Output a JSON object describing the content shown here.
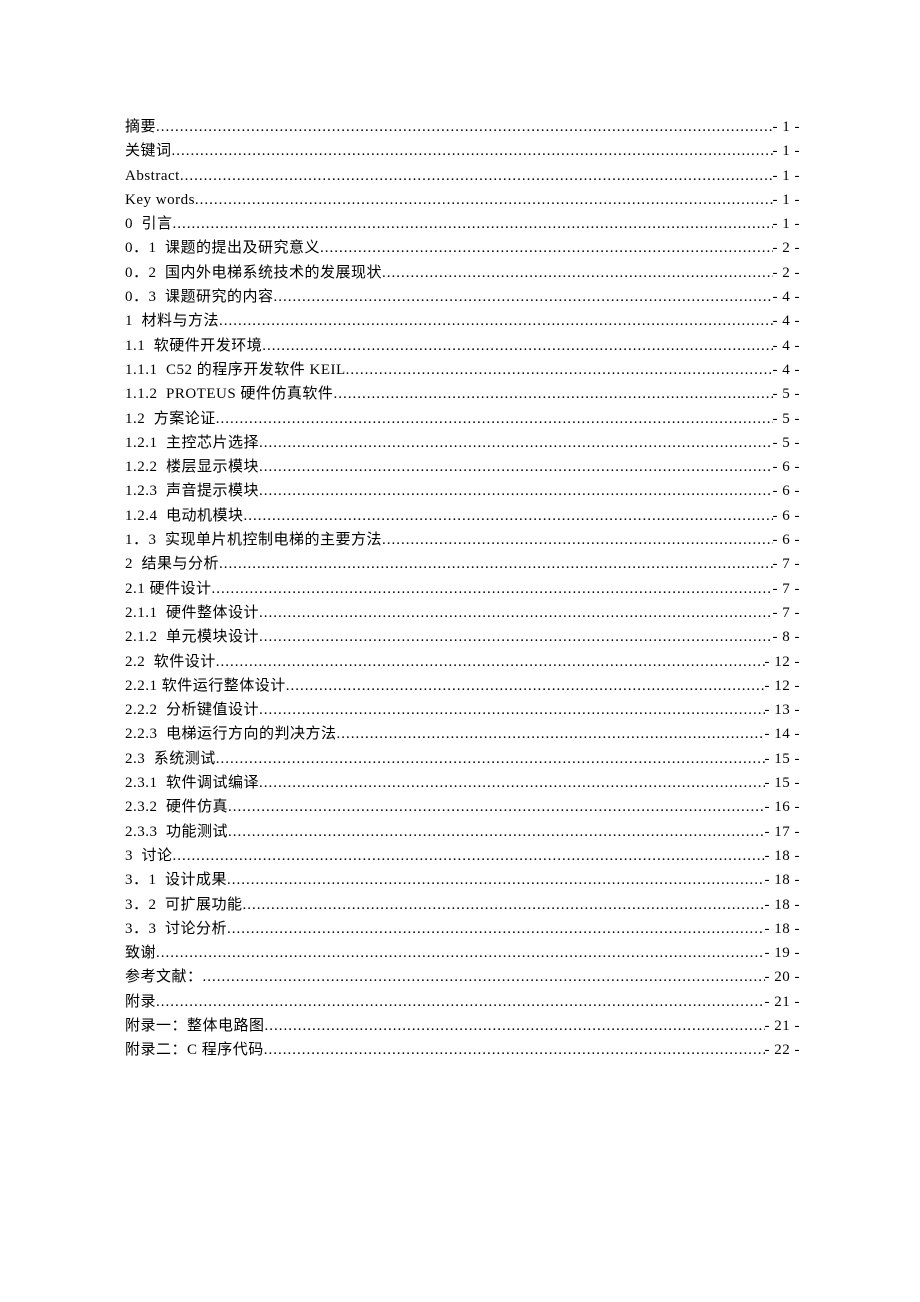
{
  "toc": [
    {
      "label": "摘要",
      "page": "- 1 -"
    },
    {
      "label": "关键词",
      "page": "- 1 -"
    },
    {
      "label": "Abstract",
      "page": "- 1 -"
    },
    {
      "label": "Key words",
      "page": "- 1 -"
    },
    {
      "label": "0  引言",
      "page": "- 1 -"
    },
    {
      "label": "0．1  课题的提出及研究意义",
      "page": "- 2 -"
    },
    {
      "label": "0．2  国内外电梯系统技术的发展现状",
      "page": "- 2 -"
    },
    {
      "label": "0．3  课题研究的内容",
      "page": "- 4 -"
    },
    {
      "label": "1  材料与方法",
      "page": "- 4 -"
    },
    {
      "label": "1.1  软硬件开发环境",
      "page": "- 4 -"
    },
    {
      "label": "1.1.1  C52 的程序开发软件 KEIL",
      "page": "- 4 -",
      "sc": true
    },
    {
      "label": "1.1.2  PROTEUS 硬件仿真软件",
      "page": "- 5 -",
      "sc": true
    },
    {
      "label": "1.2  方案论证",
      "page": "- 5 -"
    },
    {
      "label": "1.2.1  主控芯片选择",
      "page": "- 5 -"
    },
    {
      "label": "1.2.2  楼层显示模块",
      "page": "- 6 -"
    },
    {
      "label": "1.2.3  声音提示模块",
      "page": "- 6 -"
    },
    {
      "label": "1.2.4  电动机模块",
      "page": "- 6 -"
    },
    {
      "label": "1．3  实现单片机控制电梯的主要方法",
      "page": "- 6 -"
    },
    {
      "label": "2  结果与分析",
      "page": "- 7 -"
    },
    {
      "label": "2.1 硬件设计",
      "page": "- 7 -"
    },
    {
      "label": "2.1.1  硬件整体设计",
      "page": "- 7 -"
    },
    {
      "label": "2.1.2  单元模块设计",
      "page": "- 8 -"
    },
    {
      "label": "2.2  软件设计",
      "page": "- 12 -"
    },
    {
      "label": "2.2.1 软件运行整体设计",
      "page": "- 12 -"
    },
    {
      "label": "2.2.2  分析键值设计",
      "page": "- 13 -"
    },
    {
      "label": "2.2.3  电梯运行方向的判决方法",
      "page": "- 14 -"
    },
    {
      "label": "2.3  系统测试",
      "page": "- 15 -"
    },
    {
      "label": "2.3.1  软件调试编译",
      "page": "- 15 -"
    },
    {
      "label": "2.3.2  硬件仿真",
      "page": "- 16 -"
    },
    {
      "label": "2.3.3  功能测试",
      "page": "- 17 -"
    },
    {
      "label": "3  讨论",
      "page": "- 18 -"
    },
    {
      "label": "3．1  设计成果",
      "page": "- 18 -"
    },
    {
      "label": "3．2  可扩展功能",
      "page": "- 18 -"
    },
    {
      "label": "3．3  讨论分析",
      "page": "- 18 -"
    },
    {
      "label": "致谢",
      "page": "- 19 -"
    },
    {
      "label": "参考文献：",
      "page": "- 20 -"
    },
    {
      "label": "附录",
      "page": "- 21 -"
    },
    {
      "label": "附录一：整体电路图",
      "page": "- 21 -"
    },
    {
      "label": "附录二：C 程序代码",
      "page": "- 22 -"
    }
  ]
}
